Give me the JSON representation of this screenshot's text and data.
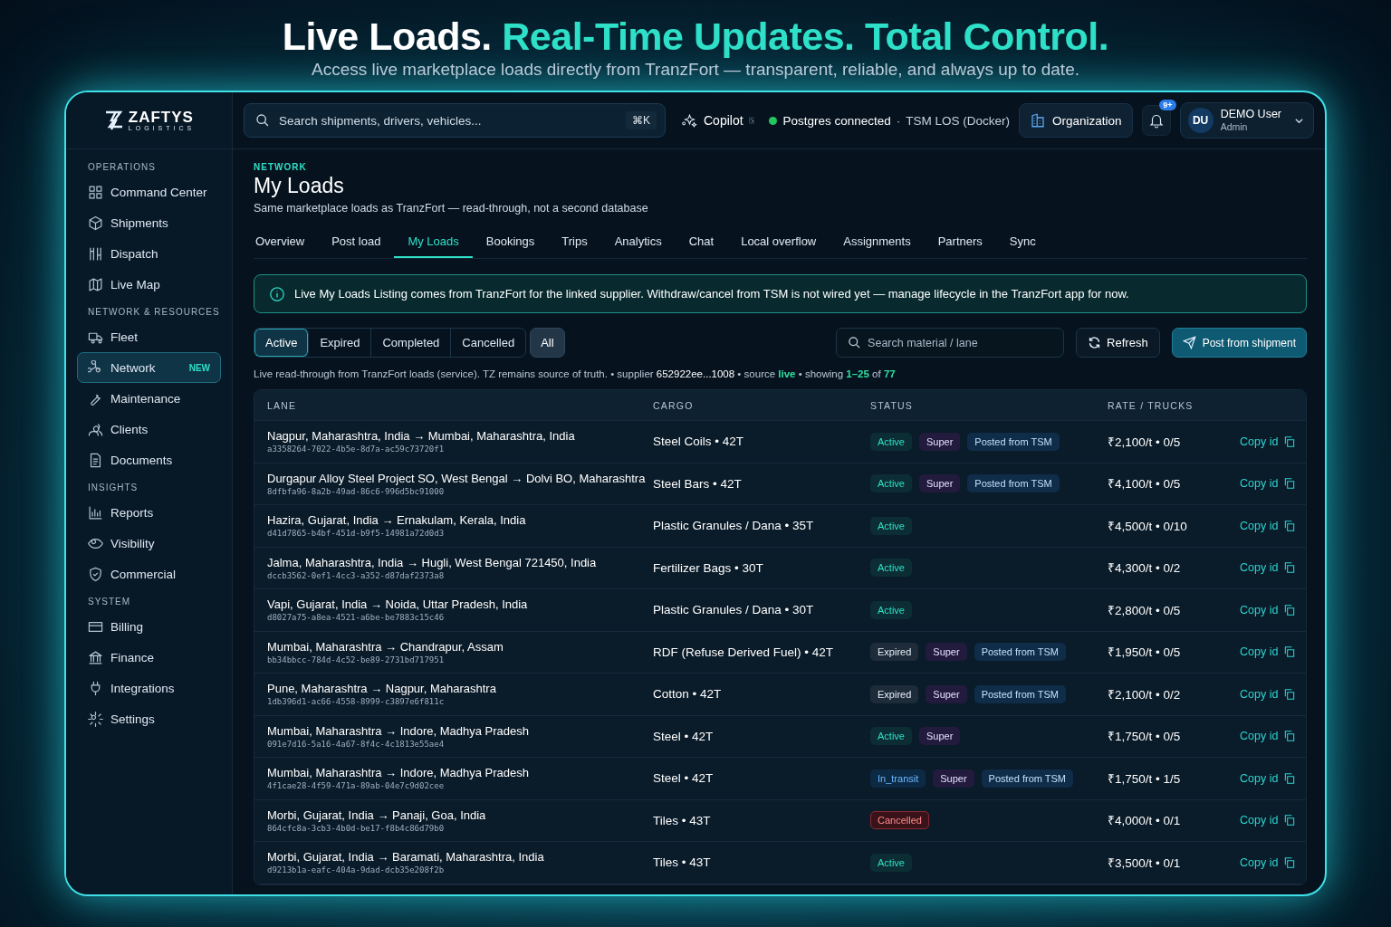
{
  "headline": {
    "lead": "Live Loads.",
    "highlight": "Real-Time Updates. Total Control.",
    "subtitle": "Access live marketplace loads directly from TranzFort — transparent, reliable, and always up to date."
  },
  "sidebar": {
    "logo": {
      "name": "ZAFTYS",
      "tagline": "LOGISTICS"
    },
    "sections": [
      {
        "title": "OPERATIONS",
        "items": [
          {
            "label": "Command Center",
            "selected": false
          },
          {
            "label": "Shipments",
            "selected": false
          },
          {
            "label": "Dispatch",
            "selected": false
          },
          {
            "label": "Live Map",
            "selected": false
          }
        ]
      },
      {
        "title": "NETWORK & RESOURCES",
        "items": [
          {
            "label": "Fleet",
            "selected": false
          },
          {
            "label": "Network",
            "selected": true,
            "badge": "NEW"
          },
          {
            "label": "Maintenance",
            "selected": false
          },
          {
            "label": "Clients",
            "selected": false
          },
          {
            "label": "Documents",
            "selected": false
          }
        ]
      },
      {
        "title": "INSIGHTS",
        "items": [
          {
            "label": "Reports",
            "selected": false
          },
          {
            "label": "Visibility",
            "selected": false
          },
          {
            "label": "Commercial",
            "selected": false
          }
        ]
      },
      {
        "title": "SYSTEM",
        "items": [
          {
            "label": "Billing",
            "selected": false
          },
          {
            "label": "Finance",
            "selected": false
          },
          {
            "label": "Integrations",
            "selected": false
          },
          {
            "label": "Settings",
            "selected": false
          }
        ]
      }
    ]
  },
  "topbar": {
    "search": {
      "placeholder": "Search shipments, drivers, vehicles...",
      "shortcut": "⌘K"
    },
    "copilot": "Copilot",
    "status": {
      "label": "Postgres connected",
      "separator": "·",
      "detail": "TSM LOS (Docker)",
      "color": "#22c55e"
    },
    "organization": "Organization",
    "notifications": "9+",
    "user": {
      "initials": "DU",
      "name": "DEMO User",
      "role": "Admin"
    }
  },
  "page": {
    "eyebrow": "NETWORK",
    "title": "My Loads",
    "subtitle": "Same marketplace loads as TranzFort — read-through, not a second database",
    "tabs": [
      {
        "label": "Overview",
        "selected": false
      },
      {
        "label": "Post load",
        "selected": false
      },
      {
        "label": "My Loads",
        "selected": true
      },
      {
        "label": "Bookings",
        "selected": false
      },
      {
        "label": "Trips",
        "selected": false
      },
      {
        "label": "Analytics",
        "selected": false
      },
      {
        "label": "Chat",
        "selected": false
      },
      {
        "label": "Local overflow",
        "selected": false
      },
      {
        "label": "Assignments",
        "selected": false
      },
      {
        "label": "Partners",
        "selected": false
      },
      {
        "label": "Sync",
        "selected": false
      }
    ],
    "notice": "Live My Loads Listing comes from TranzFort for the linked supplier. Withdraw/cancel from TSM is not wired yet — manage lifecycle in the TranzFort app for now.",
    "filters": [
      {
        "label": "Active",
        "selected": true
      },
      {
        "label": "Expired",
        "selected": false
      },
      {
        "label": "Completed",
        "selected": false
      },
      {
        "label": "Cancelled",
        "selected": false
      }
    ],
    "all_button": "All",
    "search": {
      "placeholder": "Search material / lane"
    },
    "refresh": "Refresh",
    "post_button": "Post from shipment",
    "info": [
      {
        "kind": "plain",
        "text": "Live read-through from TranzFort loads (service). TZ remains source of truth. • supplier "
      },
      {
        "kind": "value",
        "text": "652922ee...1008"
      },
      {
        "kind": "plain",
        "text": " • source "
      },
      {
        "kind": "accent",
        "text": "live"
      },
      {
        "kind": "plain",
        "text": " • showing "
      },
      {
        "kind": "accent",
        "text": "1–25"
      },
      {
        "kind": "plain",
        "text": " of "
      },
      {
        "kind": "accent",
        "text": "77"
      }
    ]
  },
  "table": {
    "columns": [
      "LANE",
      "CARGO",
      "STATUS",
      "RATE / TRUCKS"
    ],
    "rows": [
      {
        "lane": "Nagpur, Maharashtra, India → Mumbai, Maharashtra, India",
        "id": "a3358264-7022-4b5e-8d7a-ac59c73720f1",
        "cargo": "Steel Coils • 42T",
        "status": {
          "label": "Active",
          "kind": "active"
        },
        "tags": [
          {
            "label": "Super",
            "kind": "super"
          },
          {
            "label": "Posted from TSM",
            "kind": "tsm"
          }
        ],
        "rate": "₹2,100/t • 0/5",
        "action": "Copy id"
      },
      {
        "lane": "Durgapur Alloy Steel Project SO, West Bengal → Dolvi BO, Maharashtra",
        "id": "8dfbfa96-8a2b-49ad-86c6-996d5bc91000",
        "cargo": "Steel Bars • 42T",
        "status": {
          "label": "Active",
          "kind": "active"
        },
        "tags": [
          {
            "label": "Super",
            "kind": "super"
          },
          {
            "label": "Posted from TSM",
            "kind": "tsm"
          }
        ],
        "rate": "₹4,100/t • 0/5",
        "action": "Copy id"
      },
      {
        "lane": "Hazira, Gujarat, India → Ernakulam, Kerala, India",
        "id": "d41d7865-b4bf-451d-b9f5-14981a72d0d3",
        "cargo": "Plastic Granules / Dana • 35T",
        "status": {
          "label": "Active",
          "kind": "active"
        },
        "tags": [],
        "rate": "₹4,500/t • 0/10",
        "action": "Copy id"
      },
      {
        "lane": "Jalma, Maharashtra, India → Hugli, West Bengal 721450, India",
        "id": "dccb3562-0ef1-4cc3-a352-d87daf2373a8",
        "cargo": "Fertilizer Bags • 30T",
        "status": {
          "label": "Active",
          "kind": "active"
        },
        "tags": [],
        "rate": "₹4,300/t • 0/2",
        "action": "Copy id"
      },
      {
        "lane": "Vapi, Gujarat, India → Noida, Uttar Pradesh, India",
        "id": "d8027a75-a8ea-4521-a6be-be7883c15c46",
        "cargo": "Plastic Granules / Dana • 30T",
        "status": {
          "label": "Active",
          "kind": "active"
        },
        "tags": [],
        "rate": "₹2,800/t • 0/5",
        "action": "Copy id"
      },
      {
        "lane": "Mumbai, Maharashtra → Chandrapur, Assam",
        "id": "bb34bbcc-784d-4c52-be89-2731bd717951",
        "cargo": "RDF (Refuse Derived Fuel) • 42T",
        "status": {
          "label": "Expired",
          "kind": "expired"
        },
        "tags": [
          {
            "label": "Super",
            "kind": "super"
          },
          {
            "label": "Posted from TSM",
            "kind": "tsm"
          }
        ],
        "rate": "₹1,950/t • 0/5",
        "action": "Copy id"
      },
      {
        "lane": "Pune, Maharashtra → Nagpur, Maharashtra",
        "id": "1db396d1-ac66-4558-8999-c3897e6f811c",
        "cargo": "Cotton • 42T",
        "status": {
          "label": "Expired",
          "kind": "expired"
        },
        "tags": [
          {
            "label": "Super",
            "kind": "super"
          },
          {
            "label": "Posted from TSM",
            "kind": "tsm"
          }
        ],
        "rate": "₹2,100/t • 0/2",
        "action": "Copy id"
      },
      {
        "lane": "Mumbai, Maharashtra → Indore, Madhya Pradesh",
        "id": "091e7d16-5a16-4a67-8f4c-4c1813e55ae4",
        "cargo": "Steel • 42T",
        "status": {
          "label": "Active",
          "kind": "active"
        },
        "tags": [
          {
            "label": "Super",
            "kind": "super"
          }
        ],
        "rate": "₹1,750/t • 0/5",
        "action": "Copy id"
      },
      {
        "lane": "Mumbai, Maharashtra → Indore, Madhya Pradesh",
        "id": "4f1cae28-4f59-471a-89ab-04e7c9d02cee",
        "cargo": "Steel • 42T",
        "status": {
          "label": "In_transit",
          "kind": "in_transit"
        },
        "tags": [
          {
            "label": "Super",
            "kind": "super"
          },
          {
            "label": "Posted from TSM",
            "kind": "tsm"
          }
        ],
        "rate": "₹1,750/t • 1/5",
        "action": "Copy id"
      },
      {
        "lane": "Morbi, Gujarat, India → Panaji, Goa, India",
        "id": "864cfc8a-3cb3-4b0d-be17-f8b4c86d79b0",
        "cargo": "Tiles • 43T",
        "status": {
          "label": "Cancelled",
          "kind": "cancelled"
        },
        "tags": [],
        "rate": "₹4,000/t • 0/1",
        "action": "Copy id"
      },
      {
        "lane": "Morbi, Gujarat, India → Baramati, Maharashtra, India",
        "id": "d9213b1a-eafc-404a-9dad-dcb35e208f2b",
        "cargo": "Tiles • 43T",
        "status": {
          "label": "Active",
          "kind": "active"
        },
        "tags": [],
        "rate": "₹3,500/t • 0/1",
        "action": "Copy id"
      }
    ]
  }
}
